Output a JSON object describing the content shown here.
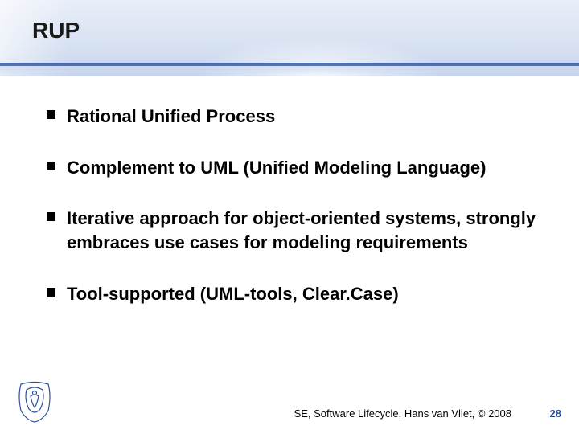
{
  "title": "RUP",
  "bullets": [
    "Rational Unified Process",
    "Complement to UML (Unified Modeling Language)",
    "Iterative approach for object-oriented systems, strongly embraces use cases for modeling requirements",
    "Tool-supported (UML-tools, Clear.Case)"
  ],
  "footer": "SE, Software Lifecycle, Hans van Vliet, © 2008",
  "page_number": "28",
  "colors": {
    "accent": "#2a4f9a",
    "header_gradient_top": "#e9eef8",
    "header_gradient_bottom": "#c6d3ea"
  }
}
